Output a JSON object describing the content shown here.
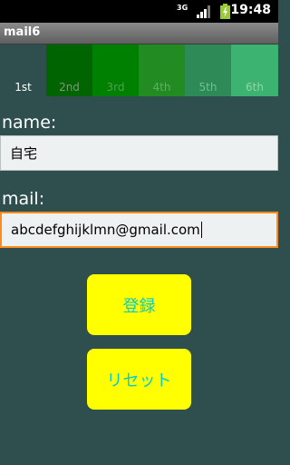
{
  "status": {
    "network": "3G",
    "time": "19:48"
  },
  "app": {
    "title": "mail6"
  },
  "tabs": [
    {
      "label": "1st",
      "bg": "#2f4f4f",
      "color": "#ffffff"
    },
    {
      "label": "2nd",
      "bg": "#006400",
      "color": "#7a9a7a"
    },
    {
      "label": "3rd",
      "bg": "#008000",
      "color": "#4fa04f"
    },
    {
      "label": "4th",
      "bg": "#228b22",
      "color": "#5fb05f"
    },
    {
      "label": "5th",
      "bg": "#2e8b57",
      "color": "#6fbf8f"
    },
    {
      "label": "6th",
      "bg": "#3cb371",
      "color": "#8fd6a8"
    }
  ],
  "form": {
    "name_label": "name:",
    "name_value": "自宅",
    "mail_label": "mail:",
    "mail_value": "abcdefghijklmn@gmail.com"
  },
  "buttons": {
    "register": "登録",
    "reset": "リセット"
  },
  "colors": {
    "background": "#2f4f4f",
    "button_bg": "#ffff00",
    "button_text": "#00ced1",
    "focus_border": "#ff8c1a"
  }
}
